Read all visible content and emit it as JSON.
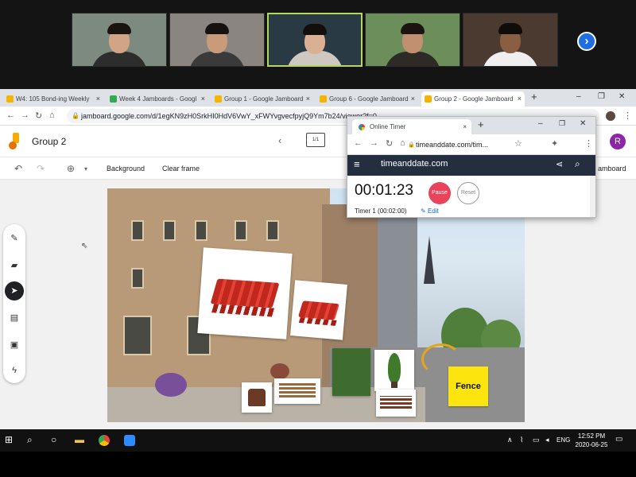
{
  "zoom": {
    "participants": [
      {
        "bg": "#7d8a7f",
        "skin": "#d2a486",
        "hair": "#1a1410",
        "shirt": "#2d2d2d"
      },
      {
        "bg": "#8a8580",
        "skin": "#c89c7a",
        "hair": "#161210",
        "shirt": "#3a3a3a"
      },
      {
        "bg": "#2a3a44",
        "skin": "#d9b094",
        "hair": "#120e0c",
        "shirt": "#cfc8c0"
      },
      {
        "bg": "#6b8e5a",
        "skin": "#c09070",
        "hair": "#1c140f",
        "shirt": "#2e2a26"
      },
      {
        "bg": "#4a3a30",
        "skin": "#8a5e40",
        "hair": "#0f0c0a",
        "shirt": "#efefef"
      }
    ],
    "next_icon": "›"
  },
  "browser": {
    "tabs": [
      {
        "label": "W4: 105 Bond-ing Weekly",
        "icon_color": "#f4b400"
      },
      {
        "label": "Week 4 Jamboards - Googl",
        "icon_color": "#34a853"
      },
      {
        "label": "Group 1 - Google Jamboard",
        "icon_color": "#f4b400"
      },
      {
        "label": "Group 6 - Google Jamboard",
        "icon_color": "#f4b400"
      },
      {
        "label": "Group 2 - Google Jamboard",
        "icon_color": "#f4b400"
      }
    ],
    "new_tab": "+",
    "url": "jamboard.google.com/d/1egKN9zH0SrkHI0HdV6VwY_xFWYvgvecfpyjQ9Ym7b24/viewer?f=0"
  },
  "jamboard": {
    "title": "Group 2",
    "frame_indicator": "1/1",
    "avatar_letter": "R",
    "toolbar": {
      "background_label": "Background",
      "clear_frame_label": "Clear frame",
      "right_label": "amboard"
    },
    "fence_note": "Fence"
  },
  "timer": {
    "tab_title": "Online Timer",
    "url": "timeanddate.com/tim...",
    "brand": "timeanddate.com",
    "time": "00:01:23",
    "pause_label": "Pause",
    "reset_label": "Reset",
    "subtitle": "Timer 1 (00:02:00)",
    "edit_label": "Edit"
  },
  "taskbar": {
    "lang": "ENG",
    "time": "12:52 PM",
    "date": "2020-06-25"
  }
}
